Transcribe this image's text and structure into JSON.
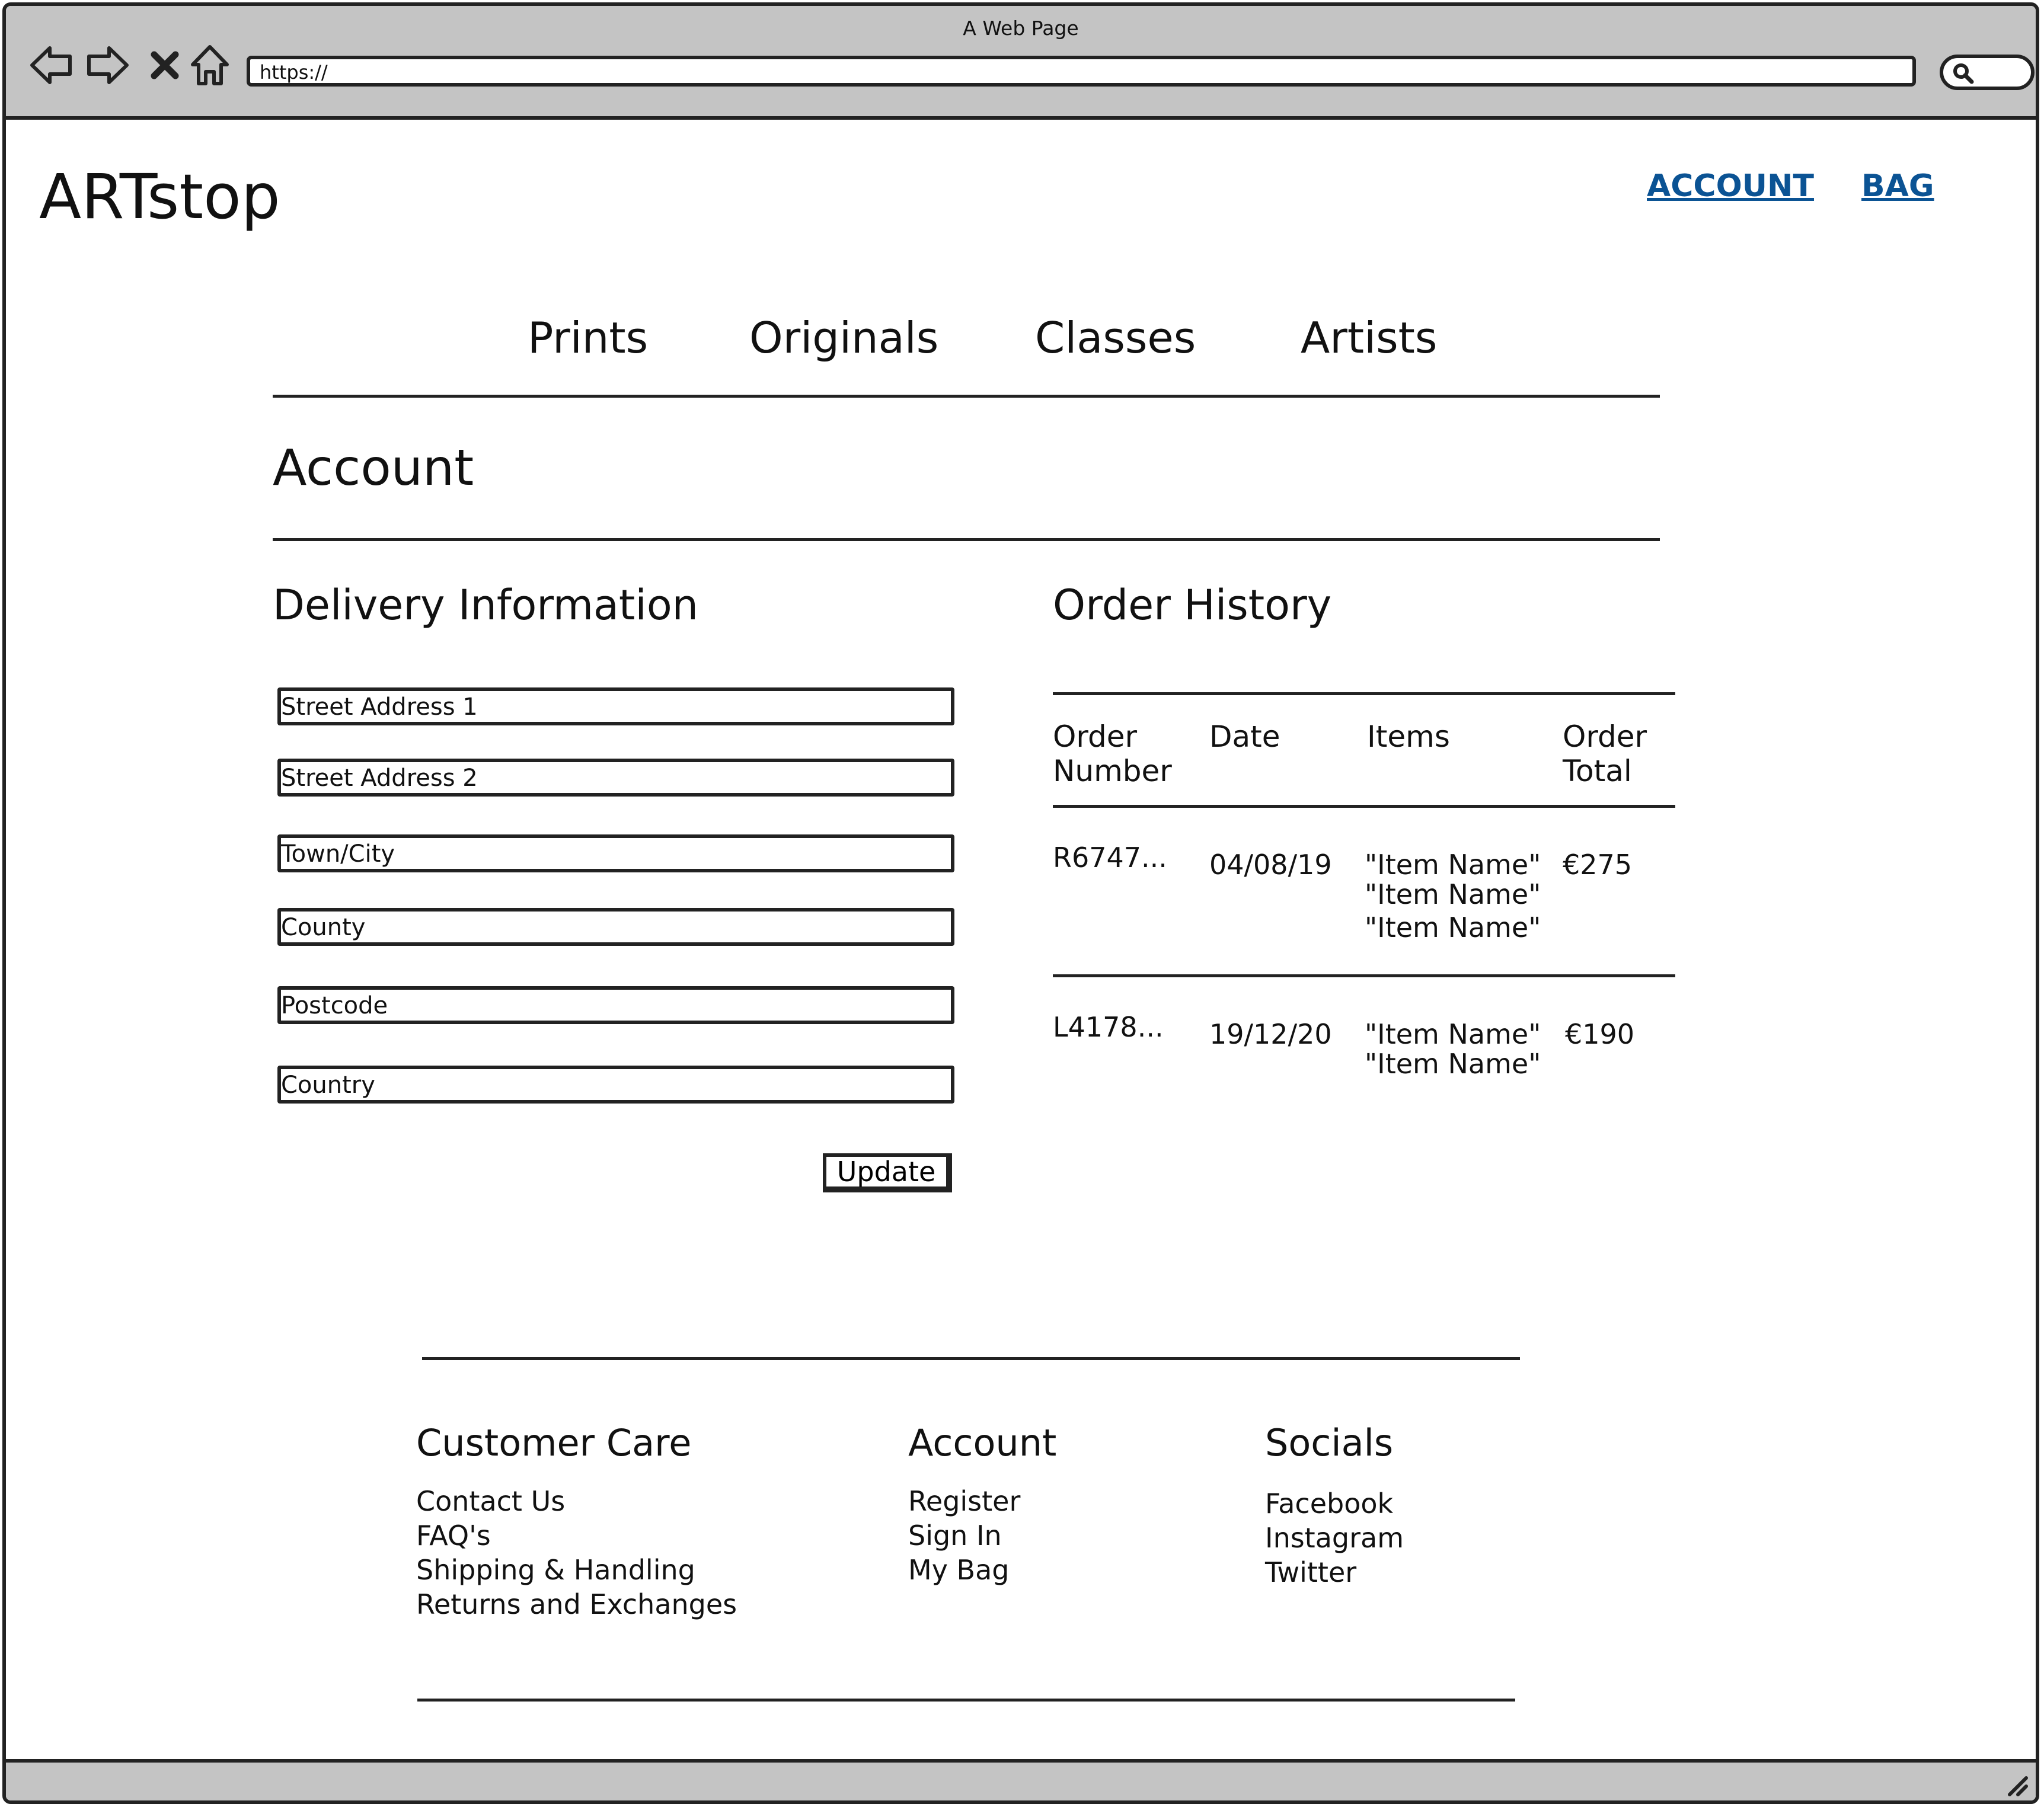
{
  "window": {
    "title": "A Web Page",
    "url": "https://"
  },
  "header": {
    "logo": "ARTstop",
    "links": {
      "account": "ACCOUNT",
      "bag": "BAG"
    }
  },
  "nav": {
    "items": [
      "Prints",
      "Originals",
      "Classes",
      "Artists"
    ]
  },
  "page": {
    "title": "Account"
  },
  "delivery": {
    "title": "Delivery Information",
    "fields": [
      "Street Address 1",
      "Street Address 2",
      "Town/City",
      "County",
      "Postcode",
      "Country"
    ],
    "update_label": "Update"
  },
  "orders": {
    "title": "Order History",
    "headers": [
      "Order Number",
      "Date",
      "Items",
      "Order Total"
    ],
    "rows": [
      {
        "number": "R6747...",
        "date": "04/08/19",
        "items": [
          "\"Item Name\"",
          "\"Item Name\"",
          "\"Item Name\""
        ],
        "total": "€275"
      },
      {
        "number": "L4178...",
        "date": "19/12/20",
        "items": [
          "\"Item Name\"",
          "\"Item Name\""
        ],
        "total": "€190"
      }
    ]
  },
  "footer": {
    "columns": [
      {
        "title": "Customer Care",
        "links": [
          "Contact Us",
          "FAQ's",
          "Shipping & Handling",
          "Returns and Exchanges"
        ]
      },
      {
        "title": "Account",
        "links": [
          "Register",
          "Sign In",
          "My Bag"
        ]
      },
      {
        "title": "Socials",
        "links": [
          "Facebook",
          "Instagram",
          "Twitter"
        ]
      }
    ]
  },
  "icons": [
    "back-icon",
    "forward-icon",
    "close-icon",
    "home-icon",
    "search-icon",
    "resize-grip-icon"
  ]
}
